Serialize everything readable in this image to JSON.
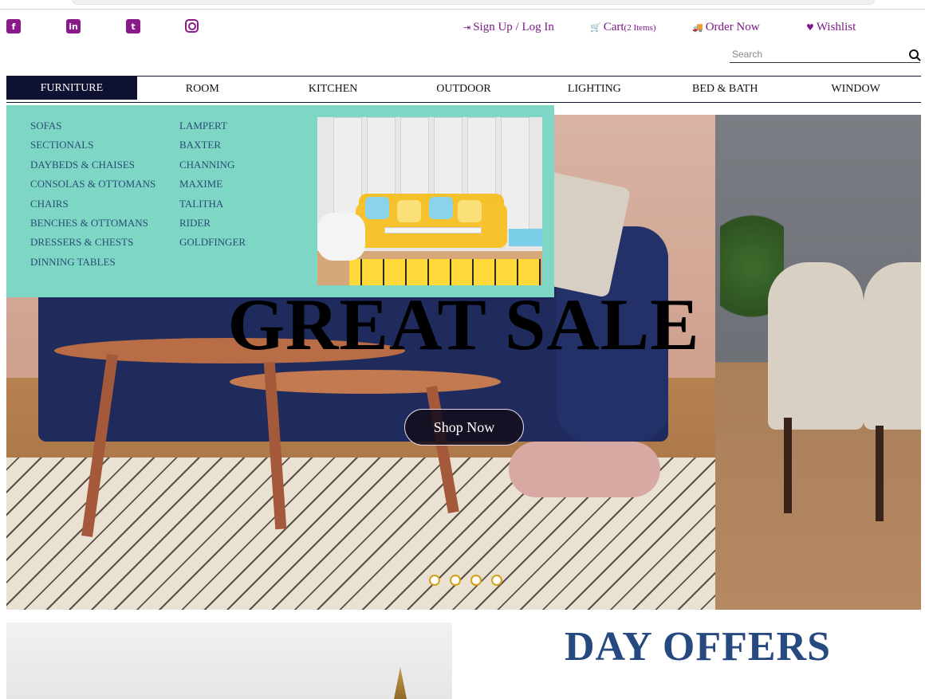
{
  "header": {
    "social": [
      "facebook-icon",
      "linkedin-icon",
      "twitter-icon",
      "instagram-icon"
    ],
    "links": {
      "signup": "Sign Up / Log In",
      "cart": "Cart",
      "cart_count": "(2 Items)",
      "order": "Order Now",
      "wishlist": "Wishlist"
    },
    "search_placeholder": "Search"
  },
  "nav": {
    "items": [
      "FURNITURE",
      "ROOM",
      "KITCHEN",
      "OUTDOOR",
      "LIGHTING",
      "BED & BATH",
      "WINDOW"
    ],
    "active": "FURNITURE"
  },
  "mega_menu": {
    "col1": [
      "SOFAS",
      "SECTIONALS",
      "DAYBEDS & CHAISES",
      "CONSOLAS & OTTOMANS",
      "CHAIRS",
      "BENCHES & OTTOMANS",
      "DRESSERS & CHESTS",
      "DINNING TABLES"
    ],
    "col2": [
      "LAMPERT",
      "BAXTER",
      "CHANNING",
      "MAXIME",
      "TALITHA",
      "RIDER",
      "GOLDFINGER"
    ]
  },
  "hero": {
    "title": "GREAT SALE",
    "button": "Shop Now",
    "slides": 4
  },
  "section": {
    "title": "DAY OFFERS"
  },
  "colors": {
    "accent": "#7a1a86",
    "nav_active": "#0f1133",
    "mega_bg": "#7ed6c4",
    "offers_title": "#26497f"
  }
}
